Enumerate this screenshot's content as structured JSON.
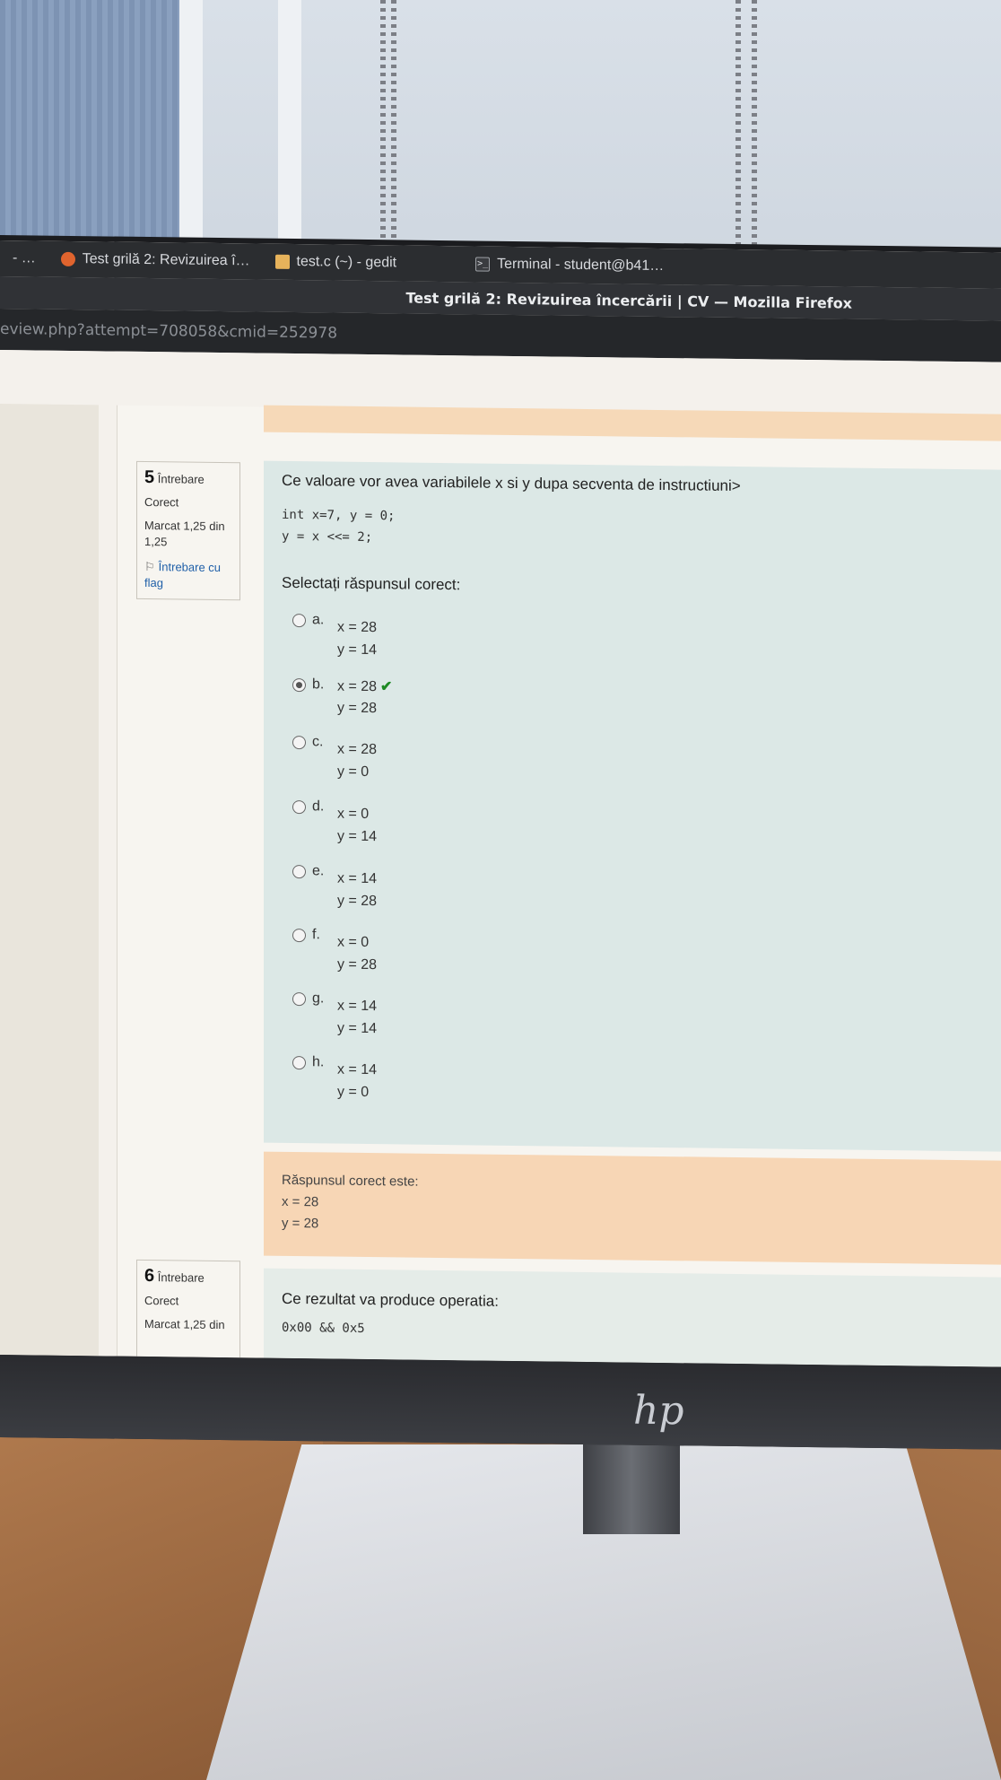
{
  "os_taskbar": {
    "prefix": "- …",
    "tabs": [
      {
        "label": "Test grilă 2: Revizuirea î…",
        "icon": "firefox-icon"
      },
      {
        "label": "test.c (~) - gedit",
        "icon": "gedit-icon"
      },
      {
        "label": "Terminal - student@b41…",
        "icon": "terminal-icon"
      }
    ]
  },
  "window": {
    "title": "Test grilă 2: Revizuirea încercării | CV — Mozilla Firefox"
  },
  "urlbar": {
    "url": "eview.php?attempt=708058&cmid=252978"
  },
  "question5": {
    "info": {
      "number": "5",
      "word": "Întrebare",
      "status": "Corect",
      "mark": "Marcat 1,25 din 1,25",
      "flag": "Întrebare cu flag"
    },
    "text": "Ce valoare vor avea variabilele x si y dupa secventa de instructiuni>",
    "code_line1": "int x=7, y = 0;",
    "code_line2": "y = x <<= 2;",
    "prompt": "Selectați răspunsul corect:",
    "options": [
      {
        "letter": "a.",
        "line1": "x = 28",
        "line2": "y = 14",
        "selected": false
      },
      {
        "letter": "b.",
        "line1": "x = 28",
        "line2": "y = 28",
        "selected": true,
        "correct_mark": "✔"
      },
      {
        "letter": "c.",
        "line1": "x = 28",
        "line2": "y = 0",
        "selected": false
      },
      {
        "letter": "d.",
        "line1": "x = 0",
        "line2": "y = 14",
        "selected": false
      },
      {
        "letter": "e.",
        "line1": "x = 14",
        "line2": "y = 28",
        "selected": false
      },
      {
        "letter": "f.",
        "line1": "x = 0",
        "line2": "y = 28",
        "selected": false
      },
      {
        "letter": "g.",
        "line1": "x = 14",
        "line2": "y = 14",
        "selected": false
      },
      {
        "letter": "h.",
        "line1": "x = 14",
        "line2": "y = 0",
        "selected": false
      }
    ],
    "correct_answer": {
      "label": "Răspunsul corect este:",
      "line1": "x = 28",
      "line2": "y = 28"
    }
  },
  "question6": {
    "info": {
      "number": "6",
      "word": "Întrebare",
      "status": "Corect",
      "mark": "Marcat 1,25 din"
    },
    "text": "Ce rezultat va produce operatia:",
    "code": "0x00 && 0x5"
  },
  "monitor": {
    "brand": "hp"
  },
  "colors": {
    "answer_banner": "#f7d6b5",
    "question_bg": "#dce8e6",
    "check": "#1e8a24",
    "flag_link": "#1f5fa8"
  }
}
